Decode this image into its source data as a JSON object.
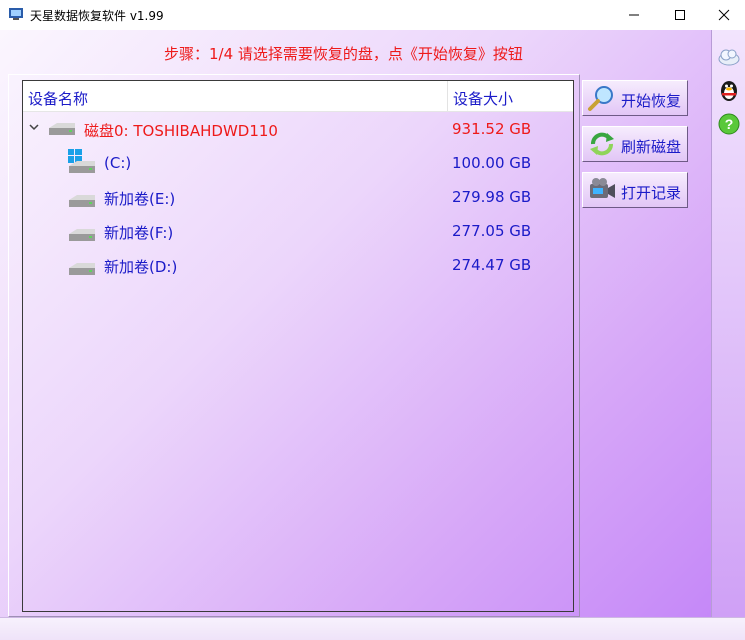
{
  "window": {
    "title": "天星数据恢复软件 v1.99"
  },
  "instruction": "步骤：1/4 请选择需要恢复的盘，点《开始恢复》按钮",
  "list": {
    "columns": {
      "name": "设备名称",
      "size": "设备大小"
    },
    "rows": [
      {
        "name": "磁盘0: TOSHIBAHDWD110",
        "size": "931.52 GB"
      },
      {
        "name": "(C:)",
        "size": "100.00 GB"
      },
      {
        "name": "新加卷(E:)",
        "size": "279.98 GB"
      },
      {
        "name": "新加卷(F:)",
        "size": "277.05 GB"
      },
      {
        "name": "新加卷(D:)",
        "size": "274.47 GB"
      }
    ]
  },
  "buttons": {
    "start": "开始恢复",
    "refresh": "刷新磁盘",
    "open_log": "打开记录"
  },
  "colors": {
    "accent_blue": "#1b1bc8",
    "alert_red": "#ee1a1a",
    "background_purple": "#c588f8"
  },
  "icons": {
    "sidebar": [
      "cloud-icon",
      "qq-penguin-icon",
      "help-icon"
    ]
  }
}
